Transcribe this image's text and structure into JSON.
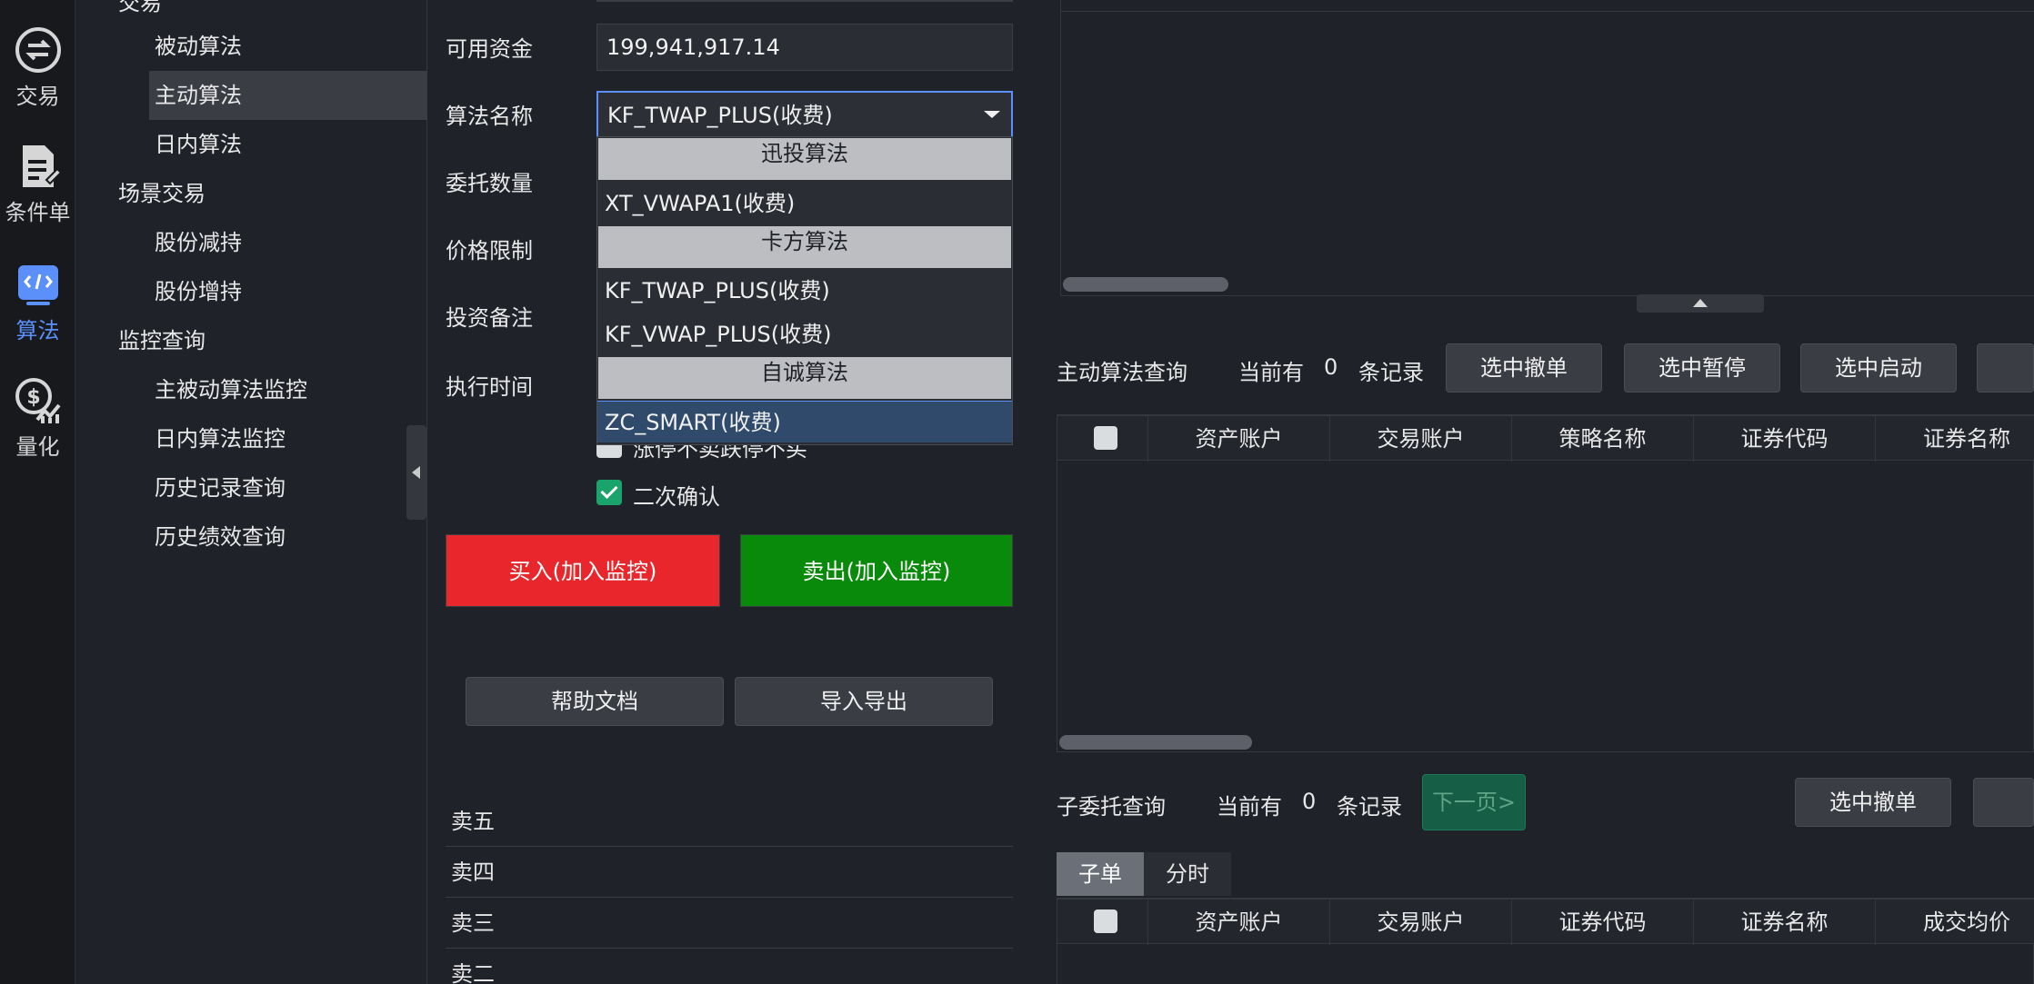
{
  "rail": {
    "items": [
      {
        "label": "交易",
        "icon": "exchange-icon"
      },
      {
        "label": "条件单",
        "icon": "condition-order-icon"
      },
      {
        "label": "算法",
        "icon": "algorithm-icon"
      },
      {
        "label": "量化",
        "icon": "quant-icon"
      }
    ]
  },
  "nav": {
    "items": [
      {
        "label": "交易"
      },
      {
        "label": "被动算法"
      },
      {
        "label": "主动算法"
      },
      {
        "label": "日内算法"
      },
      {
        "label": "场景交易"
      },
      {
        "label": "股份减持"
      },
      {
        "label": "股份增持"
      },
      {
        "label": "监控查询"
      },
      {
        "label": "主被动算法监控"
      },
      {
        "label": "日内算法监控"
      },
      {
        "label": "历史记录查询"
      },
      {
        "label": "历史绩效查询"
      }
    ]
  },
  "form": {
    "available_funds_label": "可用资金",
    "available_funds_value": "199,941,917.14",
    "algo_name_label": "算法名称",
    "algo_name_value": "KF_TWAP_PLUS(收费)",
    "quantity_label": "委托数量",
    "price_limit_label": "价格限制",
    "remark_label": "投资备注",
    "exec_time_label": "执行时间",
    "limit_option_label": "涨停不卖跌停不买",
    "confirm_label": "二次确认",
    "buy_label": "买入(加入监控)",
    "sell_label": "卖出(加入监控)",
    "help_label": "帮助文档",
    "import_export_label": "导入导出"
  },
  "dropdown": {
    "groups": [
      "迅投算法",
      "卡方算法",
      "自诚算法"
    ],
    "options": [
      "XT_VWAPA1(收费)",
      "KF_TWAP_PLUS(收费)",
      "KF_VWAP_PLUS(收费)",
      "ZC_SMART(收费)"
    ]
  },
  "orderbook": {
    "rows": [
      "卖五",
      "卖四",
      "卖三",
      "卖二"
    ]
  },
  "active_query": {
    "title": "主动算法查询",
    "prefix": "当前有",
    "count": "0",
    "suffix": "条记录",
    "buttons": [
      "选中撤单",
      "选中暂停",
      "选中启动"
    ],
    "columns": [
      "资产账户",
      "交易账户",
      "策略名称",
      "证券代码",
      "证券名称"
    ]
  },
  "child_query": {
    "title": "子委托查询",
    "prefix": "当前有",
    "count": "0",
    "suffix": "条记录",
    "next_page": "下一页>",
    "cancel_button": "选中撤单",
    "tabs": [
      "子单",
      "分时"
    ],
    "columns": [
      "资产账户",
      "交易账户",
      "证券代码",
      "证券名称",
      "成交均价"
    ]
  },
  "colors": {
    "accent": "#5b8ff9",
    "buy": "#e8262b",
    "sell": "#0a8a0a",
    "check": "#1aa36a"
  }
}
